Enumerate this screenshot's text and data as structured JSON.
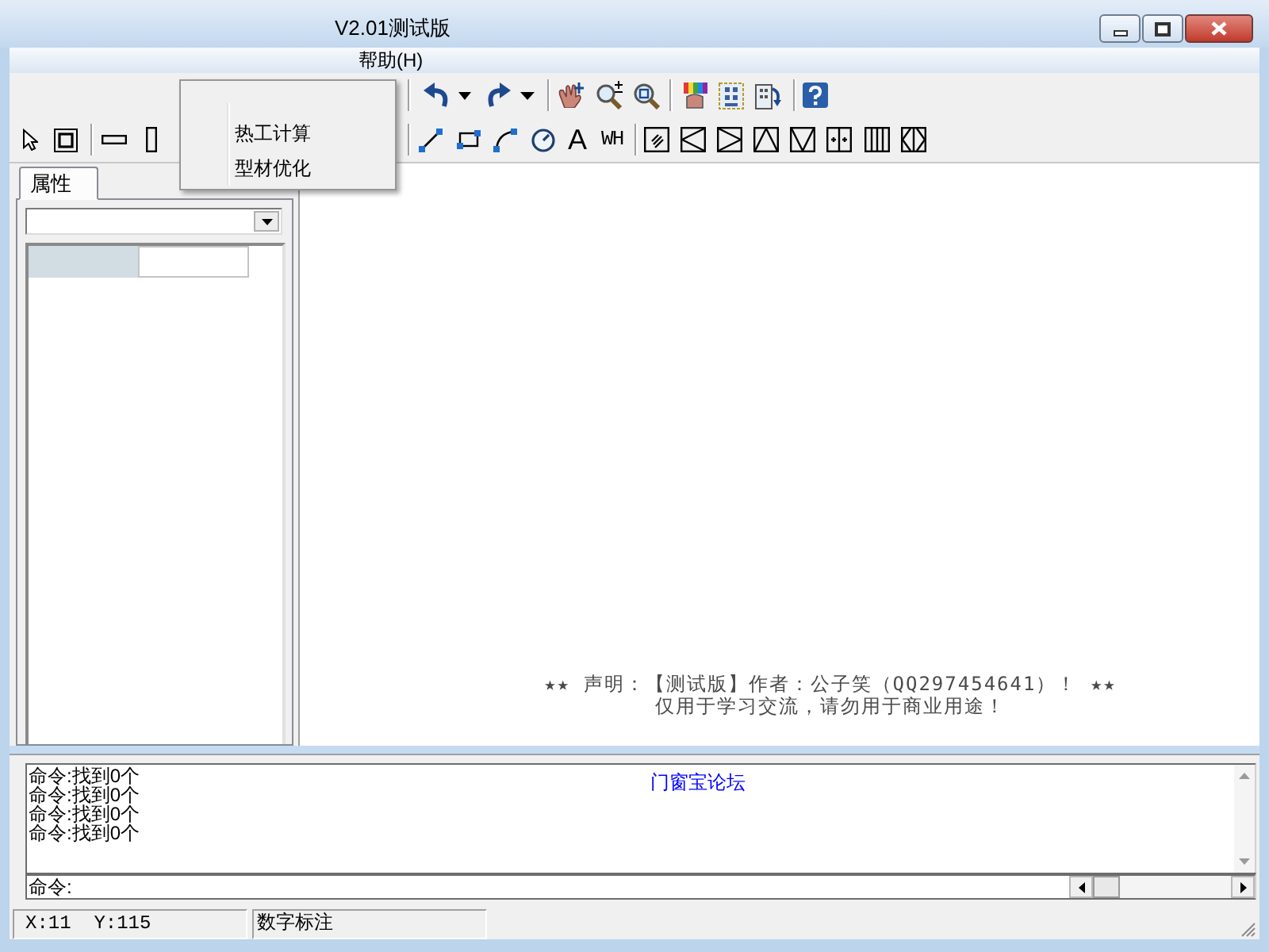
{
  "window": {
    "title": "V2.01测试版"
  },
  "menu_bar": {
    "items": [
      {
        "label": "帮助(H)"
      }
    ]
  },
  "dropdown_menu": {
    "items": [
      {
        "label": "热工计算"
      },
      {
        "label": "型材优化"
      }
    ]
  },
  "draw_toolbar": {
    "text_tools": [
      {
        "label": "A",
        "kind": "text"
      },
      {
        "label": "WH",
        "kind": "dimension"
      }
    ]
  },
  "side_panel": {
    "tabs": [
      {
        "label": "属性",
        "selected": true
      }
    ]
  },
  "canvas": {
    "notice": [
      "★★ 声明：【测试版】作者：公子笑（QQ297454641）！ ★★",
      "仅用于学习交流，请勿用于商业用途！"
    ]
  },
  "output": {
    "lines": [
      "命令:找到0个",
      "命令:找到0个",
      "命令:找到0个",
      "命令:找到0个"
    ],
    "link": "门窗宝论坛"
  },
  "command_line": {
    "prompt": "命令:"
  },
  "status_bar": {
    "cells": [
      "X:11  Y:115",
      "数字标注"
    ]
  }
}
